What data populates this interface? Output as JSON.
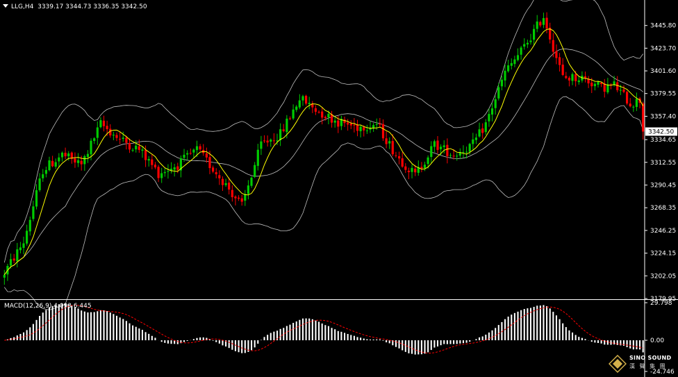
{
  "header": {
    "symbol": "LLG,H4",
    "ohlc": "3339.17 3344.73 3336.35 3342.50"
  },
  "macd_header": {
    "label": "MACD(12,26,9) 4.093 6.445"
  },
  "current_price": "3342.50",
  "logo": {
    "name": "SINO SOUND",
    "chinese": "漢 聲 集 團"
  },
  "colors": {
    "background": "#000000",
    "up": "#00cc00",
    "down": "#ff0000",
    "ma": "#ffff00",
    "bands": "#c0c0c0",
    "macd_hist": "#ffffff",
    "macd_signal": "#ff0000"
  },
  "chart_data": [
    {
      "type": "candlestick",
      "name": "LLG,H4",
      "y_ticks": [
        "3445.80",
        "3423.70",
        "3401.60",
        "3379.55",
        "3357.40",
        "3334.65",
        "3312.55",
        "3290.45",
        "3268.35",
        "3246.25",
        "3224.15",
        "3202.05",
        "3179.95"
      ],
      "ylim": [
        3179.95,
        3467.9
      ],
      "overlays": [
        "Bollinger Bands",
        "Moving Average"
      ],
      "anchors": {
        "x": [
          0,
          6,
          12,
          18,
          24,
          30,
          36,
          42,
          48,
          54,
          60,
          68,
          74,
          80,
          86,
          92,
          98,
          104,
          110,
          116,
          122,
          128,
          134,
          140,
          146,
          150,
          156,
          162,
          168,
          174,
          180,
          186,
          190,
          195,
          200
        ],
        "y": [
          3205,
          3235,
          3305,
          3320,
          3310,
          3350,
          3335,
          3325,
          3302,
          3310,
          3325,
          3295,
          3270,
          3330,
          3340,
          3375,
          3362,
          3352,
          3347,
          3350,
          3320,
          3300,
          3330,
          3320,
          3330,
          3350,
          3400,
          3425,
          3455,
          3395,
          3395,
          3385,
          3388,
          3370,
          3375
        ]
      },
      "last_close": 3342.5
    },
    {
      "type": "bar",
      "name": "MACD(12,26,9)",
      "y_ticks": [
        "29.798",
        "0.00",
        "-24.746"
      ],
      "ylim": [
        -24.746,
        29.798
      ],
      "values_macd": "4.093",
      "values_signal": "6.445"
    }
  ]
}
